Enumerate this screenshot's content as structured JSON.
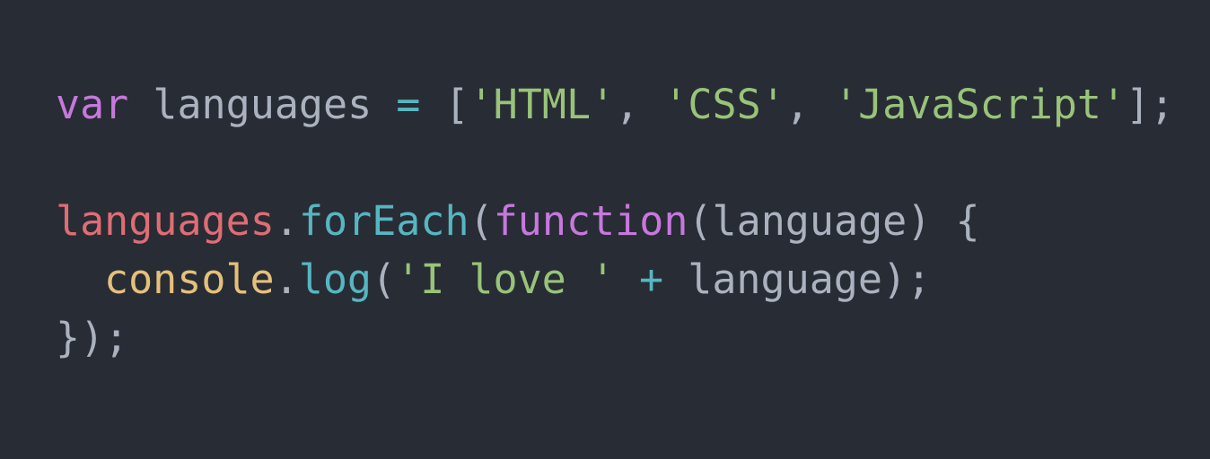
{
  "colors": {
    "background": "#282c34",
    "keyword": "#c678dd",
    "identifier": "#abb2bf",
    "variable": "#e06c75",
    "function": "#56b6c2",
    "string": "#98c379",
    "object": "#e5c07b",
    "operator": "#56b6c2",
    "punctuation": "#abb2bf"
  },
  "code": {
    "line1": [
      {
        "text": "var",
        "type": "keyword"
      },
      {
        "text": " languages ",
        "type": "identifier"
      },
      {
        "text": "=",
        "type": "operator"
      },
      {
        "text": " [",
        "type": "punctuation"
      },
      {
        "text": "'HTML'",
        "type": "string"
      },
      {
        "text": ", ",
        "type": "punctuation"
      },
      {
        "text": "'CSS'",
        "type": "string"
      },
      {
        "text": ", ",
        "type": "punctuation"
      },
      {
        "text": "'JavaScript'",
        "type": "string"
      },
      {
        "text": "];",
        "type": "punctuation"
      }
    ],
    "line2": [],
    "line3": [
      {
        "text": "languages",
        "type": "variable"
      },
      {
        "text": ".",
        "type": "punctuation"
      },
      {
        "text": "forEach",
        "type": "function"
      },
      {
        "text": "(",
        "type": "punctuation"
      },
      {
        "text": "function",
        "type": "keyword"
      },
      {
        "text": "(language) {",
        "type": "identifier"
      }
    ],
    "line4": [
      {
        "text": "console",
        "type": "object"
      },
      {
        "text": ".",
        "type": "punctuation"
      },
      {
        "text": "log",
        "type": "function"
      },
      {
        "text": "(",
        "type": "punctuation"
      },
      {
        "text": "'I love '",
        "type": "string"
      },
      {
        "text": " + ",
        "type": "operator"
      },
      {
        "text": "language);",
        "type": "identifier"
      }
    ],
    "line5": [
      {
        "text": "});",
        "type": "punctuation"
      }
    ]
  }
}
